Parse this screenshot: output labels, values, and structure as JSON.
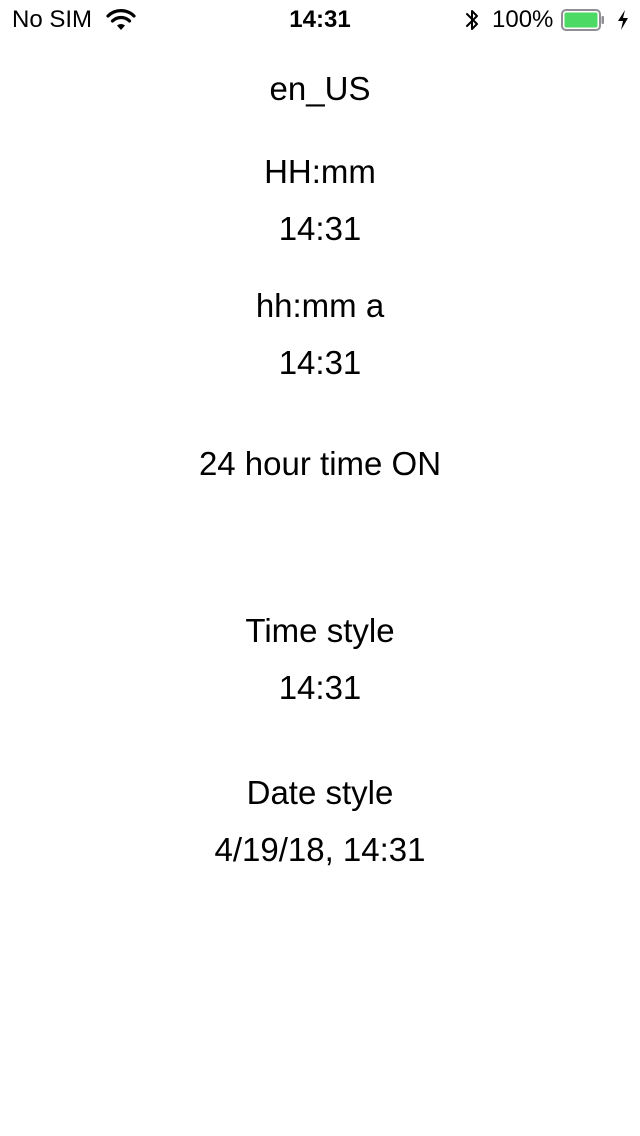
{
  "status_bar": {
    "carrier": "No SIM",
    "time": "14:31",
    "battery_percent": "100%",
    "battery_level": 1.0,
    "battery_color": "#4cd964",
    "icons": [
      "wifi-icon",
      "bluetooth-icon",
      "battery-icon",
      "charging-bolt-icon"
    ]
  },
  "content": {
    "locale": "en_US",
    "format_24h_label": "HH:mm",
    "format_24h_value": "14:31",
    "format_12h_label": "hh:mm a",
    "format_12h_value": "14:31",
    "hour24_status": "24 hour time ON",
    "time_style_label": "Time style",
    "time_style_value": "14:31",
    "date_style_label": "Date style",
    "date_style_value": "4/19/18, 14:31"
  }
}
